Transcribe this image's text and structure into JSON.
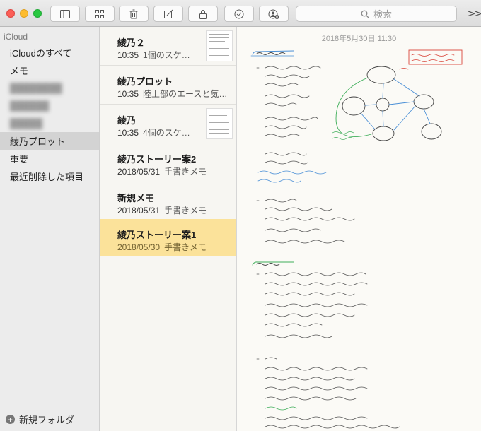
{
  "toolbar": {
    "buttons": [
      "sidebar-toggle-icon",
      "gallery-icon",
      "trash-icon",
      "compose-icon",
      "lock-icon",
      "checklist-icon",
      "add-people-icon"
    ],
    "search_placeholder": "検索",
    "overflow": ">>"
  },
  "sidebar": {
    "section": "iCloud",
    "items": [
      {
        "label": "iCloudのすべて"
      },
      {
        "label": "メモ"
      },
      {
        "label": "████████"
      },
      {
        "label": "██████"
      },
      {
        "label": "█████"
      },
      {
        "label": "綾乃プロット"
      },
      {
        "label": "重要"
      },
      {
        "label": "最近削除した項目"
      }
    ],
    "selected_index": 5,
    "new_folder": "新規フォルダ"
  },
  "notes": [
    {
      "title": "綾乃２",
      "time": "10:35",
      "snippet": "1個のスケ…",
      "has_thumb": true
    },
    {
      "title": "綾乃プロット",
      "time": "10:35",
      "snippet": "陸上部のエースと気…",
      "has_thumb": false
    },
    {
      "title": "綾乃",
      "time": "10:35",
      "snippet": "4個のスケ…",
      "has_thumb": true
    },
    {
      "title": "綾乃ストーリー案2",
      "time": "2018/05/31",
      "snippet": "手書きメモ",
      "has_thumb": false
    },
    {
      "title": "新規メモ",
      "time": "2018/05/31",
      "snippet": "手書きメモ",
      "has_thumb": false
    },
    {
      "title": "綾乃ストーリー案1",
      "time": "2018/05/30",
      "snippet": "手書きメモ",
      "has_thumb": false
    }
  ],
  "selected_note_index": 5,
  "editor": {
    "date": "2018年5月30日 11:30"
  },
  "colors": {
    "selected_note": "#fbe29a",
    "sidebar_selected": "#d3d3d3",
    "ink": "#333333",
    "ink_blue": "#4a8fd6",
    "ink_green": "#3fae5a",
    "ink_red": "#d9453a"
  }
}
